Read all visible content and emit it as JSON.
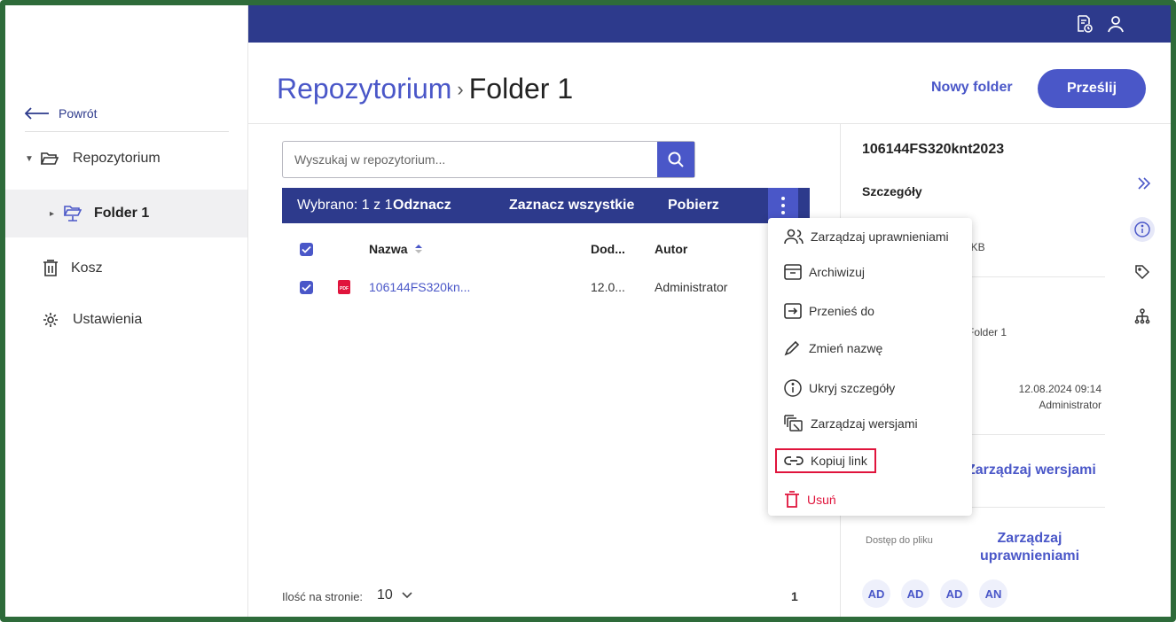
{
  "header": {
    "icons": [
      "document-clock-icon",
      "user-icon"
    ]
  },
  "sidebar": {
    "back_label": "Powrót",
    "items": [
      {
        "label": "Repozytorium",
        "icon": "folder-open-icon",
        "expanded": true
      },
      {
        "label": "Folder 1",
        "icon": "shared-folder-icon",
        "selected": true
      },
      {
        "label": "Kosz",
        "icon": "trash-icon"
      },
      {
        "label": "Ustawienia",
        "icon": "gear-icon"
      }
    ]
  },
  "breadcrumb": {
    "root": "Repozytorium",
    "separator": "›",
    "current": "Folder 1"
  },
  "actions": {
    "new_folder": "Nowy folder",
    "upload": "Prześlij"
  },
  "search": {
    "placeholder": "Wyszukaj w repozytorium...",
    "value": ""
  },
  "selection_bar": {
    "selected": "Wybrano: 1 z 1",
    "unselect": "Odznacz",
    "select_all": "Zaznacz wszystkie",
    "download": "Pobierz"
  },
  "table": {
    "columns": [
      "Nazwa",
      "Dod...",
      "Autor"
    ],
    "rows": [
      {
        "name": "106144FS320kn...",
        "added": "12.0...",
        "author": "Administrator",
        "file_type": "PDF",
        "checked": true
      }
    ]
  },
  "pagination": {
    "label": "Ilość na stronie:",
    "per_page": "10",
    "page": "1"
  },
  "context_menu": {
    "items": [
      {
        "label": "Zarządzaj uprawnieniami",
        "icon": "users-icon"
      },
      {
        "label": "Archiwizuj",
        "icon": "archive-icon"
      },
      {
        "label": "Przenieś do",
        "icon": "move-to-icon"
      },
      {
        "label": "Zmień nazwę",
        "icon": "pencil-icon"
      },
      {
        "label": "Ukryj szczegóły",
        "icon": "info-icon"
      },
      {
        "label": "Zarządzaj wersjami",
        "icon": "versions-icon"
      },
      {
        "label": "Kopiuj link",
        "icon": "link-icon",
        "highlighted": true
      },
      {
        "label": "Usuń",
        "icon": "trash-icon",
        "danger": true
      }
    ]
  },
  "details": {
    "title": "106144FS320knt2023",
    "section": "Szczegóły",
    "size_partial": "73 KB",
    "location": "Folder 1",
    "modified_date": "12.08.2024 09:14",
    "modified_by": "Administrator",
    "manage_versions": "Zarządzaj wersjami",
    "access_label": "Dostęp do pliku",
    "access_link": "Zarządzaj uprawnieniami",
    "avatars": [
      "AD",
      "AD",
      "AD",
      "AN"
    ]
  },
  "colors": {
    "primary": "#4a57c8",
    "navbar": "#2d3a8c",
    "danger": "#e0143c",
    "frame": "#2e6b3a"
  }
}
